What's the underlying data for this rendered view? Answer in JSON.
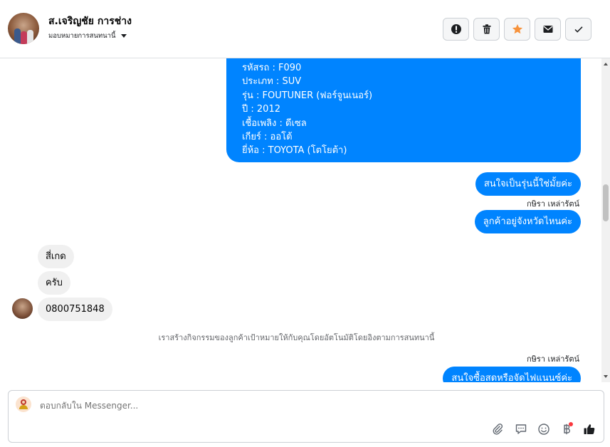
{
  "header": {
    "contact_name": "ส.เจริญชัย การช่าง",
    "assign_label": "มอบหมายการสนทนานี้",
    "buttons": [
      "mark-spam",
      "delete",
      "star",
      "mark-unread",
      "done"
    ]
  },
  "chat": {
    "vehicle_card": [
      "รหัสรถ : F090",
      "ประเภท : SUV",
      "รุ่น : FOUTUNER (ฟอร์จูนเนอร์)",
      "ปี : 2012",
      "เชื้อเพลิง : ดีเซล",
      "เกียร์ : ออโต้",
      "ยี่ห้อ : TOYOTA (โตโยต้า)"
    ],
    "out_msg_1": "สนใจเป็นรุ่นนี้ใช่มั้ยค่ะ",
    "sender_1": "กษิรา เหล่ารัตน์",
    "out_msg_2": "ลูกค้าอยู่จังหวัดไหนค่ะ",
    "in_msg_1": "สี่เกด",
    "in_msg_2": "ครับ",
    "in_msg_3": "0800751848",
    "system_note": "เราสร้างกิจกรรมของลูกค้าเป้าหมายให้กับคุณโดยอัตโนมัติโดยอิงตามการสนทนานี้",
    "sender_2": "กษิรา เหล่ารัตน์",
    "out_msg_3": "สนใจซื้อสดหรือจัดไฟแนนซ์ค่ะ"
  },
  "composer": {
    "placeholder": "ตอบกลับใน Messenger..."
  },
  "colors": {
    "accent": "#0084ff",
    "star": "#f7923b",
    "incoming_bubble": "#f0f0f0",
    "notification": "#fa383e"
  },
  "icons": [
    "exclamation-icon",
    "trash-icon",
    "star-icon",
    "envelope-icon",
    "check-icon",
    "paperclip-icon",
    "saved-reply-icon",
    "emoji-icon",
    "baht-icon",
    "thumbs-up-icon"
  ]
}
